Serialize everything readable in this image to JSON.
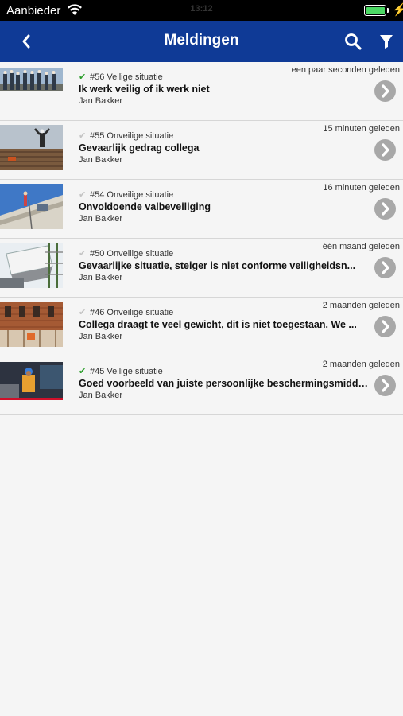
{
  "status_bar": {
    "carrier": "Aanbieder",
    "time": "13:12",
    "battery_level": 1.0
  },
  "header": {
    "title": "Meldingen",
    "back_icon": "chevron-left-icon",
    "search_icon": "search-icon",
    "filter_icon": "filter-icon",
    "color": "#0f3a96"
  },
  "notifications": [
    {
      "number": "#56",
      "type": "Veilige situatie",
      "safe": true,
      "time": "een paar seconden geleden",
      "title": "Ik werk veilig of ik werk niet",
      "author": "Jan Bakker",
      "thumbnail": "workers-group-photo"
    },
    {
      "number": "#55",
      "type": "Onveilige situatie",
      "safe": false,
      "time": "15 minuten geleden",
      "title": "Gevaarlijk gedrag collega",
      "author": "Jan Bakker",
      "thumbnail": "worker-on-rebar-photo"
    },
    {
      "number": "#54",
      "type": "Onveilige situatie",
      "safe": false,
      "time": "16 minuten geleden",
      "title": "Onvoldoende valbeveiliging",
      "author": "Jan Bakker",
      "thumbnail": "roof-worker-photo"
    },
    {
      "number": "#50",
      "type": "Onveilige situatie",
      "safe": false,
      "time": "één maand geleden",
      "title": "Gevaarlijke situatie, steiger is niet conforme veiligheidsn...",
      "author": "Jan Bakker",
      "thumbnail": "scaffolding-photo"
    },
    {
      "number": "#46",
      "type": "Onveilige situatie",
      "safe": false,
      "time": "2 maanden geleden",
      "title": "Collega draagt te veel gewicht, dit is niet toegestaan. We ...",
      "author": "Jan Bakker",
      "thumbnail": "brick-building-photo"
    },
    {
      "number": "#45",
      "type": "Veilige situatie",
      "safe": true,
      "time": "2 maanden geleden",
      "title": "Goed voorbeeld van juiste persoonlijke beschermingsmiddelen",
      "author": "Jan Bakker",
      "thumbnail": "worker-in-ppe-photo"
    }
  ]
}
